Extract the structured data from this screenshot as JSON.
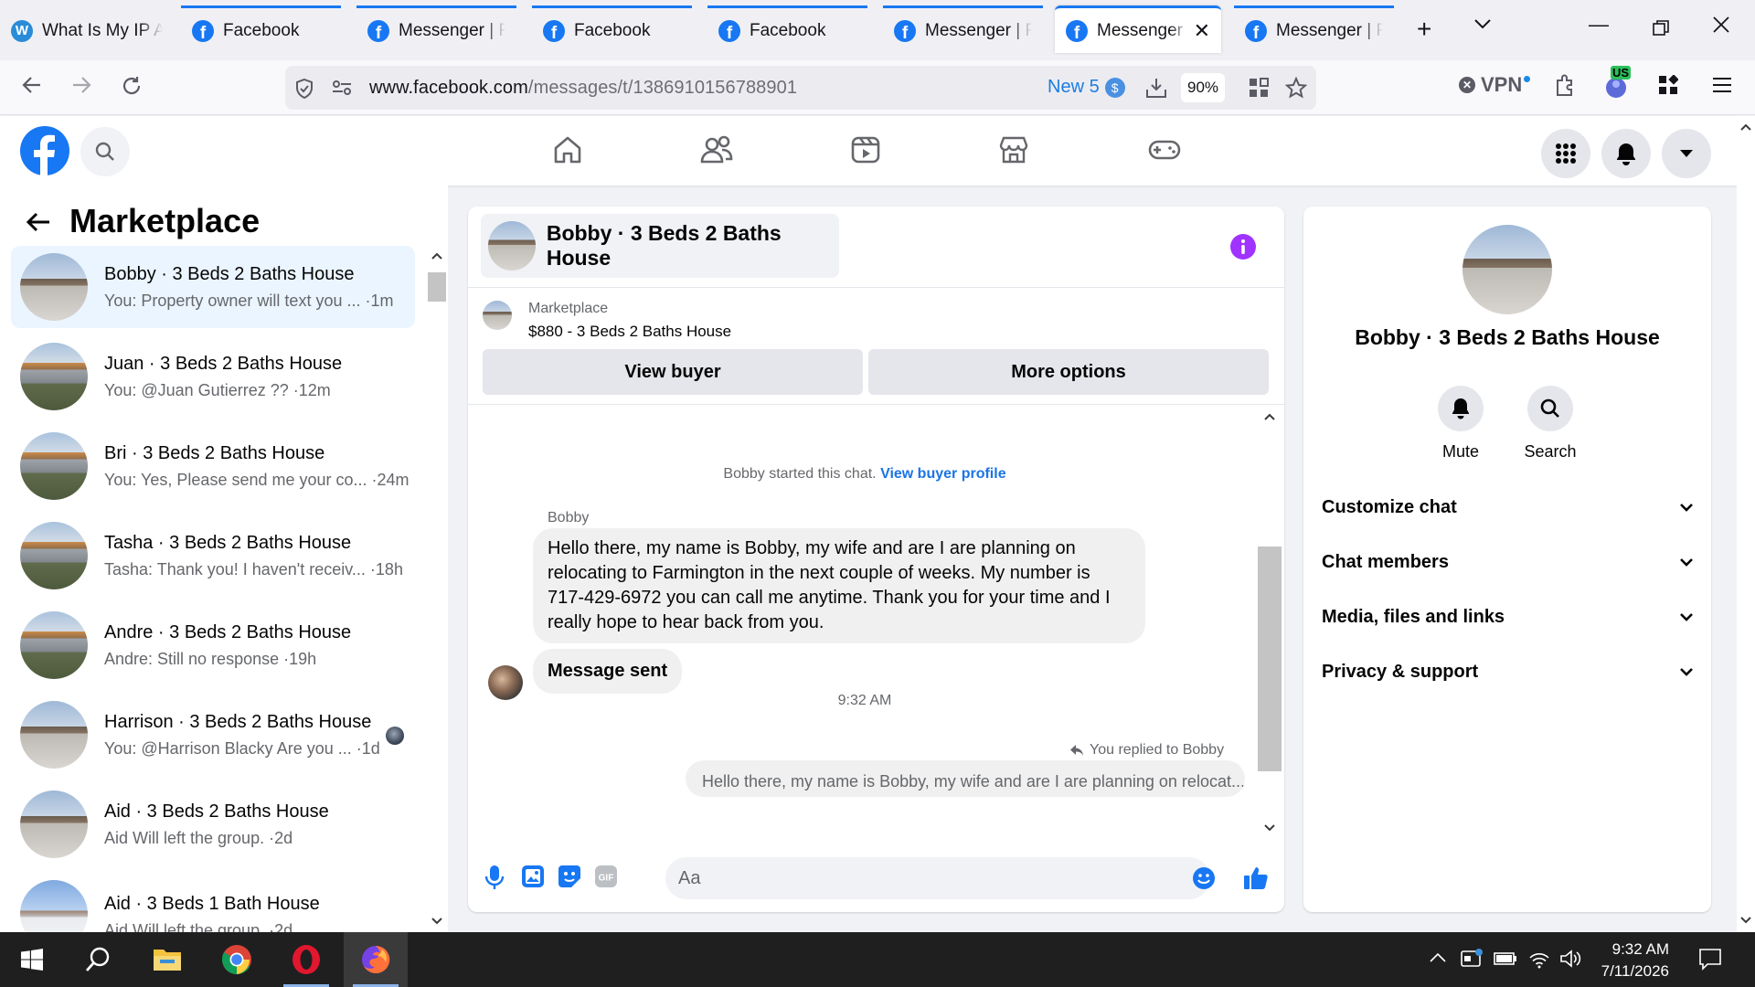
{
  "browser": {
    "tabs": [
      {
        "title": "What Is My IP Address",
        "icon": "whatismyip-favicon"
      },
      {
        "title": "Facebook",
        "icon": "facebook-favicon"
      },
      {
        "title": "Messenger | Facebook",
        "icon": "facebook-favicon"
      },
      {
        "title": "Facebook",
        "icon": "facebook-favicon"
      },
      {
        "title": "Facebook",
        "icon": "facebook-favicon"
      },
      {
        "title": "Messenger | Facebook",
        "icon": "facebook-favicon"
      },
      {
        "title": "Messenger | Facebook",
        "icon": "facebook-favicon",
        "active": true
      },
      {
        "title": "Messenger | Facebook",
        "icon": "facebook-favicon"
      }
    ],
    "url_domain": "www.facebook.com",
    "url_path": "/messages/t/1386910156788901",
    "new_label": "New 5",
    "zoom": "90%",
    "vpn_label": "VPN",
    "vpn_region": "US",
    "accent_color": "#1877f2"
  },
  "sidebar": {
    "title": "Marketplace",
    "conversations": [
      {
        "name": "Bobby · 3 Beds 2 Baths House",
        "preview": "You: Property owner will text you ... ·1m",
        "selected": true,
        "thumb": "house1"
      },
      {
        "name": "Juan · 3 Beds 2 Baths House",
        "preview": "You: @Juan Gutierrez ?? ·12m",
        "thumb": "house2"
      },
      {
        "name": "Bri · 3 Beds 2 Baths House",
        "preview": "You: Yes, Please send me your co... ·24m",
        "thumb": "house2"
      },
      {
        "name": "Tasha · 3 Beds 2 Baths House",
        "preview": "Tasha: Thank you! I haven't receiv... ·18h",
        "thumb": "house2"
      },
      {
        "name": "Andre · 3 Beds 2 Baths House",
        "preview": "Andre: Still no response ·19h",
        "thumb": "house2"
      },
      {
        "name": "Harrison · 3 Beds 2 Baths House",
        "preview": "You: @Harrison Blacky Are you ... ·1d",
        "thumb": "house1"
      },
      {
        "name": "Aid · 3 Beds 2 Baths House",
        "preview": "Aid Will left the group. ·2d",
        "thumb": "house1"
      },
      {
        "name": "Aid · 3 Beds 1 Bath House",
        "preview": "Aid Will left the group. ·2d",
        "thumb": "house3"
      }
    ]
  },
  "chat": {
    "title": "Bobby · 3 Beds 2 Baths House",
    "listing_label": "Marketplace",
    "listing_title": "$880 - 3 Beds 2 Baths House",
    "view_buyer": "View buyer",
    "more_options": "More options",
    "started_text": "Bobby started this chat.",
    "view_buyer_profile": "View buyer profile",
    "sender_name": "Bobby",
    "message1": "Hello there, my name is Bobby, my wife and are I are planning on relocating to Farmington in the next couple of weeks. My number is 717-429-6972 you can call me anytime. Thank you for your time and I really hope to hear back from you.",
    "message2": "Message sent",
    "time_separator": "9:32 AM",
    "replied_label": "You replied to Bobby",
    "replied_quote": "Hello there, my name is Bobby, my wife and are I are planning on relocat...",
    "input_placeholder": "Aa"
  },
  "info_panel": {
    "name": "Bobby · 3 Beds 2 Baths House",
    "mute": "Mute",
    "search": "Search",
    "sections": [
      "Customize chat",
      "Chat members",
      "Media, files and links",
      "Privacy & support"
    ]
  },
  "taskbar": {
    "time": "9:32 AM",
    "date": "7/11/2026"
  }
}
